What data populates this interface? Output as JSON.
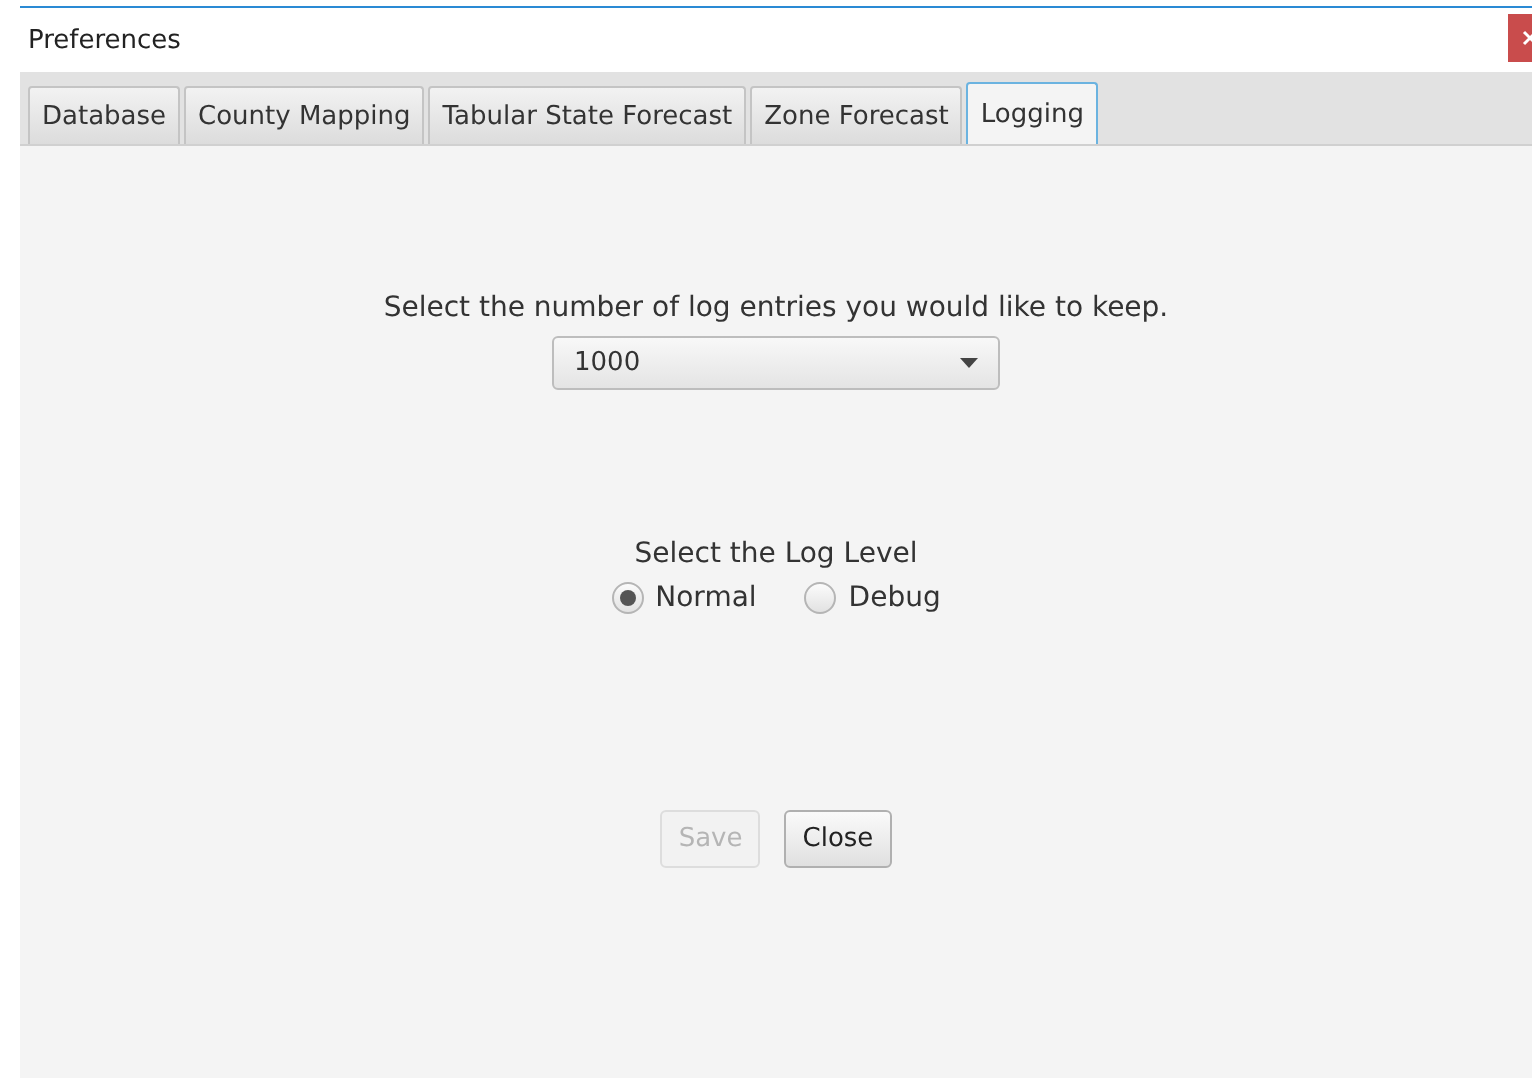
{
  "window": {
    "title": "Preferences"
  },
  "tabs": [
    {
      "label": "Database",
      "selected": false
    },
    {
      "label": "County Mapping",
      "selected": false
    },
    {
      "label": "Tabular State Forecast",
      "selected": false
    },
    {
      "label": "Zone Forecast",
      "selected": false
    },
    {
      "label": "Logging",
      "selected": true
    }
  ],
  "log_entries": {
    "prompt": "Select the number of log entries you would like to keep.",
    "value": "1000"
  },
  "log_level": {
    "prompt": "Select the Log Level",
    "options": [
      {
        "label": "Normal",
        "selected": true
      },
      {
        "label": "Debug",
        "selected": false
      }
    ]
  },
  "buttons": [
    {
      "label": "Save",
      "disabled": true
    },
    {
      "label": "Close",
      "disabled": false
    }
  ]
}
